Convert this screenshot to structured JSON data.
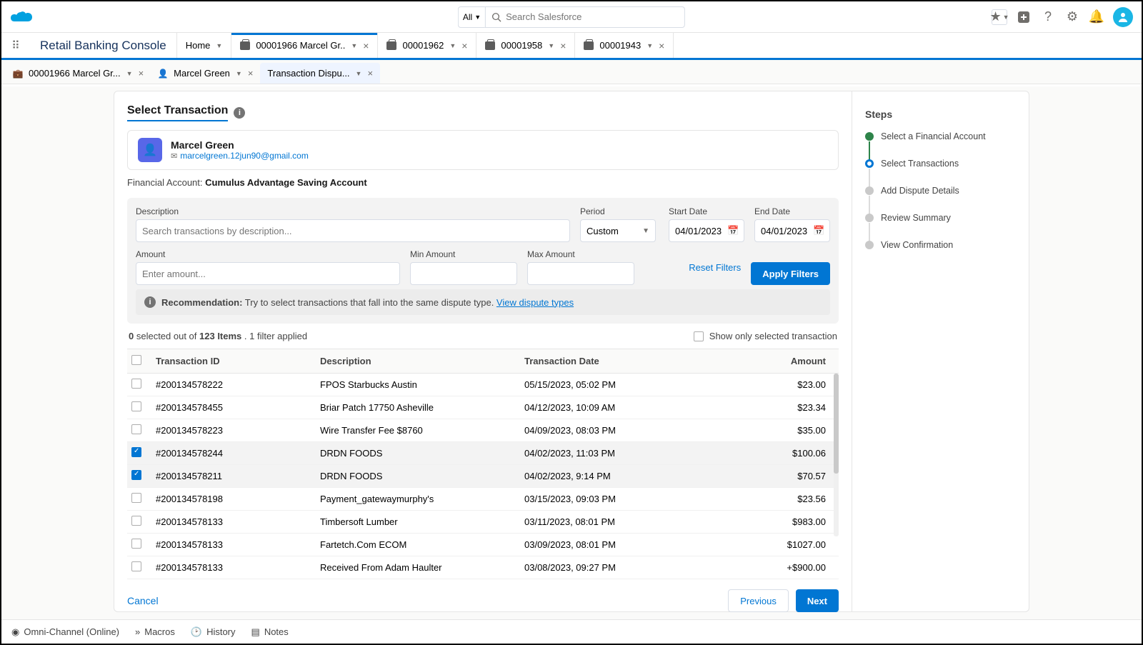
{
  "header": {
    "search_scope": "All",
    "search_placeholder": "Search Salesforce"
  },
  "nav": {
    "app_name": "Retail Banking Console",
    "home": "Home",
    "tabs": [
      {
        "label": "00001966 Marcel Gr..",
        "active": true
      },
      {
        "label": "00001962",
        "active": false
      },
      {
        "label": "00001958",
        "active": false
      },
      {
        "label": "00001943",
        "active": false
      }
    ]
  },
  "subtabs": [
    {
      "label": "00001966 Marcel Gr...",
      "icon": "case",
      "active": false
    },
    {
      "label": "Marcel Green",
      "icon": "person",
      "active": false
    },
    {
      "label": "Transaction Dispu...",
      "icon": "none",
      "active": true
    }
  ],
  "page": {
    "title": "Select Transaction",
    "customer_name": "Marcel Green",
    "customer_email": "marcelgreen.12jun90@gmail.com",
    "fin_label": "Financial Account: ",
    "fin_value": "Cumulus Advantage Saving Account"
  },
  "filters": {
    "desc_label": "Description",
    "desc_placeholder": "Search transactions by description...",
    "period_label": "Period",
    "period_value": "Custom",
    "start_label": "Start Date",
    "start_value": "04/01/2023",
    "end_label": "End Date",
    "end_value": "04/01/2023",
    "amount_label": "Amount",
    "amount_placeholder": "Enter amount...",
    "min_label": "Min Amount",
    "max_label": "Max Amount",
    "reset": "Reset Filters",
    "apply": "Apply Filters"
  },
  "reco": {
    "bold": "Recommendation:",
    "text": " Try to select transactions that fall into the same dispute type. ",
    "link": "View dispute types"
  },
  "selbar": {
    "p1": "0",
    "p2": " selected out of ",
    "p3": "123 Items",
    "p4": " . 1 filter applied",
    "show_only": "Show only selected transaction"
  },
  "table": {
    "h_id": "Transaction  ID",
    "h_desc": "Description",
    "h_date": "Transaction Date",
    "h_amt": "Amount",
    "rows": [
      {
        "id": "#200134578222",
        "desc": "FPOS Starbucks Austin",
        "date": "05/15/2023, 05:02 PM",
        "amt": "$23.00",
        "sel": false
      },
      {
        "id": "#200134578455",
        "desc": "Briar Patch 17750 Asheville",
        "date": "04/12/2023, 10:09 AM",
        "amt": "$23.34",
        "sel": false
      },
      {
        "id": "#200134578223",
        "desc": "Wire Transfer Fee $8760",
        "date": "04/09/2023, 08:03 PM",
        "amt": "$35.00",
        "sel": false
      },
      {
        "id": "#200134578244",
        "desc": "DRDN FOODS",
        "date": "04/02/2023, 11:03 PM",
        "amt": "$100.06",
        "sel": true
      },
      {
        "id": "#200134578211",
        "desc": "DRDN FOODS",
        "date": "04/02/2023, 9:14 PM",
        "amt": "$70.57",
        "sel": true
      },
      {
        "id": "#200134578198",
        "desc": "Payment_gatewaymurphy's",
        "date": "03/15/2023, 09:03 PM",
        "amt": "$23.56",
        "sel": false
      },
      {
        "id": "#200134578133",
        "desc": "Timbersoft Lumber",
        "date": "03/11/2023, 08:01 PM",
        "amt": "$983.00",
        "sel": false
      },
      {
        "id": "#200134578133",
        "desc": "Fartetch.Com ECOM",
        "date": "03/09/2023, 08:01 PM",
        "amt": "$1027.00",
        "sel": false
      },
      {
        "id": "#200134578133",
        "desc": "Received From Adam Haulter",
        "date": "03/08/2023, 09:27 PM",
        "amt": "+$900.00",
        "sel": false
      }
    ]
  },
  "footer": {
    "cancel": "Cancel",
    "prev": "Previous",
    "next": "Next"
  },
  "steps": {
    "title": "Steps",
    "items": [
      {
        "label": "Select a Financial Account",
        "state": "done"
      },
      {
        "label": "Select Transactions",
        "state": "current"
      },
      {
        "label": "Add Dispute Details",
        "state": ""
      },
      {
        "label": "Review Summary",
        "state": ""
      },
      {
        "label": "View Confirmation",
        "state": ""
      }
    ]
  },
  "bottom": {
    "omni": "Omni-Channel (Online)",
    "macros": "Macros",
    "history": "History",
    "notes": "Notes"
  }
}
